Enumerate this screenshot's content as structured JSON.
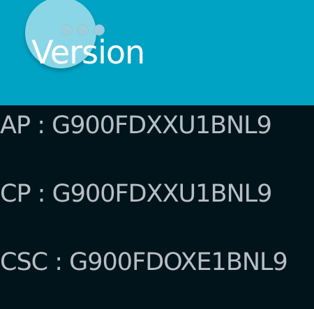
{
  "header": {
    "title": "Version",
    "menu_icon": "more-horizontal-icon"
  },
  "versions": [
    {
      "label": "AP",
      "value": "G900FDXXU1BNL9"
    },
    {
      "label": "CP",
      "value": "G900FDXXU1BNL9"
    },
    {
      "label": "CSC",
      "value": "G900FDOXE1BNL9"
    }
  ],
  "colors": {
    "header_background": "#00a3c4",
    "body_background": "#02141b",
    "primary_text": "#ffffff",
    "secondary_text": "#b8bec5"
  }
}
